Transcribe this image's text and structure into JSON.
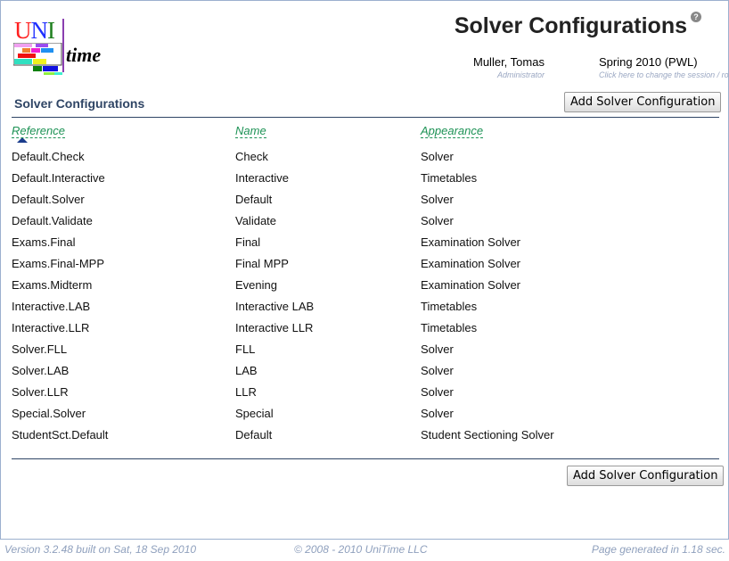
{
  "logo": {
    "letters": [
      "U",
      "N",
      "I"
    ],
    "colors": [
      "#ff2020",
      "#2030ff",
      "#208020"
    ],
    "word": "time"
  },
  "header": {
    "title": "Solver Configurations",
    "help_icon": "question-circle-icon",
    "user": "Muller, Tomas",
    "role": "Administrator",
    "session": "Spring 2010 (PWL)",
    "session_hint": "Click here to change the session / role."
  },
  "section": {
    "title": "Solver Configurations",
    "add_button": "Add Solver Configuration"
  },
  "table": {
    "columns": [
      "Reference",
      "Name",
      "Appearance"
    ],
    "sort_column": "Reference",
    "rows": [
      [
        "Default.Check",
        "Check",
        "Solver"
      ],
      [
        "Default.Interactive",
        "Interactive",
        "Timetables"
      ],
      [
        "Default.Solver",
        "Default",
        "Solver"
      ],
      [
        "Default.Validate",
        "Validate",
        "Solver"
      ],
      [
        "Exams.Final",
        "Final",
        "Examination Solver"
      ],
      [
        "Exams.Final-MPP",
        "Final MPP",
        "Examination Solver"
      ],
      [
        "Exams.Midterm",
        "Evening",
        "Examination Solver"
      ],
      [
        "Interactive.LAB",
        "Interactive LAB",
        "Timetables"
      ],
      [
        "Interactive.LLR",
        "Interactive LLR",
        "Timetables"
      ],
      [
        "Solver.FLL",
        "FLL",
        "Solver"
      ],
      [
        "Solver.LAB",
        "LAB",
        "Solver"
      ],
      [
        "Solver.LLR",
        "LLR",
        "Solver"
      ],
      [
        "Special.Solver",
        "Special",
        "Solver"
      ],
      [
        "StudentSct.Default",
        "Default",
        "Student Sectioning Solver"
      ]
    ]
  },
  "footer": {
    "version": "Version 3.2.48 built on Sat, 18 Sep 2010",
    "copyright": "© 2008 - 2010 UniTime LLC",
    "generated": "Page generated in 1.18 sec."
  }
}
